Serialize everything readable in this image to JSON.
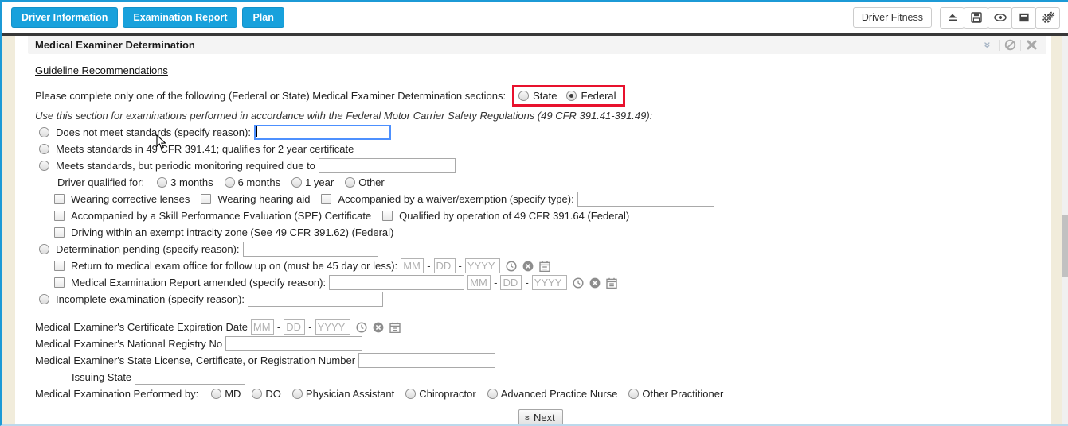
{
  "colors": {
    "accent_blue": "#18a1dc",
    "highlight_red": "#e8112d",
    "dark_bar": "#383838",
    "beige_strip": "#f1ecdb"
  },
  "toolbar": {
    "nav": [
      "Driver Information",
      "Examination Report",
      "Plan"
    ],
    "driver_fitness": "Driver Fitness",
    "icon_buttons": [
      "eject-icon",
      "save-icon",
      "eye-icon",
      "archive-icon",
      "gears-icon"
    ]
  },
  "panel": {
    "title": "Medical Examiner Determination",
    "header_icons": [
      "collapse-chevrons-icon",
      "disable-icon",
      "close-icon"
    ],
    "guideline_link": "Guideline Recommendations",
    "instruction": "Please complete only one of the following (Federal or State) Medical Examiner Determination sections:",
    "jurisdiction": {
      "options": [
        "State",
        "Federal"
      ],
      "selected": "Federal"
    },
    "federal_note": "Use this section for examinations performed in accordance with the Federal Motor Carrier Safety Regulations (49 CFR 391.41-391.49):"
  },
  "form": {
    "does_not_meet": "Does not meet standards (specify reason):",
    "meets_standards": "Meets standards in 49 CFR 391.41; qualifies for 2 year certificate",
    "periodic_monitoring": "Meets standards, but periodic monitoring required due to",
    "driver_qualified_label": "Driver qualified for:",
    "qualified_options": [
      "3 months",
      "6 months",
      "1 year",
      "Other"
    ],
    "cb_corrective": "Wearing corrective lenses",
    "cb_hearing": "Wearing hearing aid",
    "cb_waiver": "Accompanied by a waiver/exemption (specify type):",
    "cb_spe": "Accompanied by a Skill Performance Evaluation (SPE) Certificate",
    "cb_39164": "Qualified by operation of 49 CFR 391.64 (Federal)",
    "cb_intracity": "Driving within an exempt intracity zone (See 49 CFR 391.62) (Federal)",
    "determination_pending": "Determination pending (specify reason):",
    "cb_return": "Return to medical exam office for follow up on (must be 45 day or less):",
    "cb_amended": "Medical Examination Report amended (specify reason):",
    "incomplete": "Incomplete examination (specify reason):",
    "cert_expiration": "Medical Examiner's Certificate Expiration Date",
    "registry_no": "Medical Examiner's National Registry No",
    "state_license": "Medical Examiner's State License, Certificate, or Registration Number",
    "issuing_state": "Issuing State",
    "performed_by_label": "Medical Examination Performed by:",
    "performed_by_options": [
      "MD",
      "DO",
      "Physician Assistant",
      "Chiropractor",
      "Advanced Practice Nurse",
      "Other Practitioner"
    ],
    "date": {
      "mm": "MM",
      "dd": "DD",
      "yyyy": "YYYY"
    },
    "date_icons": [
      "clock-icon",
      "clear-icon",
      "calendar-icon"
    ],
    "inputs_empty_value": "",
    "next_label": "Next"
  }
}
